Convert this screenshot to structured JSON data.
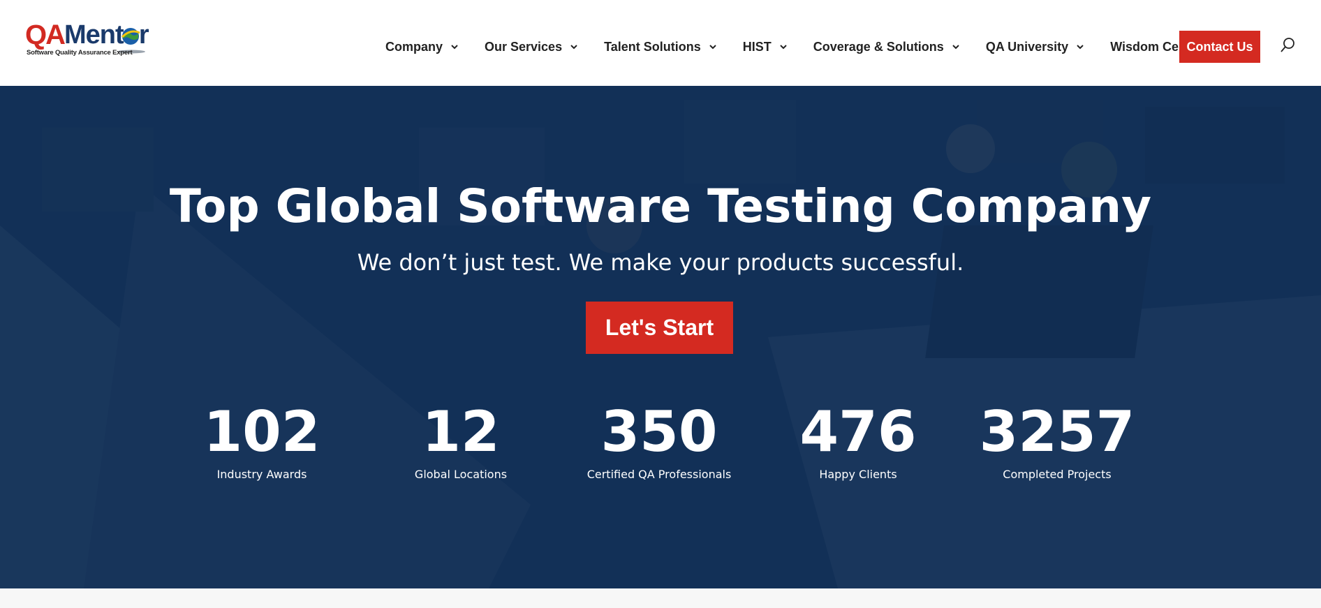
{
  "logo": {
    "qa": "QA",
    "mentor": "Mentor",
    "tagline": "Software Quality Assurance Expert"
  },
  "nav": {
    "items": [
      {
        "label": "Company",
        "icon": "chevron-down-icon"
      },
      {
        "label": "Our Services",
        "icon": "chevron-down-icon"
      },
      {
        "label": "Talent Solutions",
        "icon": "chevron-down-icon"
      },
      {
        "label": "HIST",
        "icon": "chevron-down-icon"
      },
      {
        "label": "Coverage & Solutions",
        "icon": "chevron-down-icon"
      },
      {
        "label": "QA University",
        "icon": "chevron-down-icon"
      },
      {
        "label": "Wisdom Center",
        "icon": "chevron-down-icon"
      }
    ],
    "contact_label": "Contact Us",
    "search_icon": "search-icon"
  },
  "hero": {
    "title": "Top Global Software Testing Company",
    "subtitle": "We don’t just test. We make your products successful.",
    "cta_label": "Let's Start"
  },
  "stats": [
    {
      "value": "102",
      "label": "Industry Awards"
    },
    {
      "value": "12",
      "label": "Global Locations"
    },
    {
      "value": "350",
      "label": "Certified QA Professionals"
    },
    {
      "value": "476",
      "label": "Happy Clients"
    },
    {
      "value": "3257",
      "label": "Completed Projects"
    }
  ],
  "colors": {
    "accent_red": "#d42a21",
    "brand_blue": "#1a3a6b",
    "hero_overlay": "#0e2c52"
  }
}
